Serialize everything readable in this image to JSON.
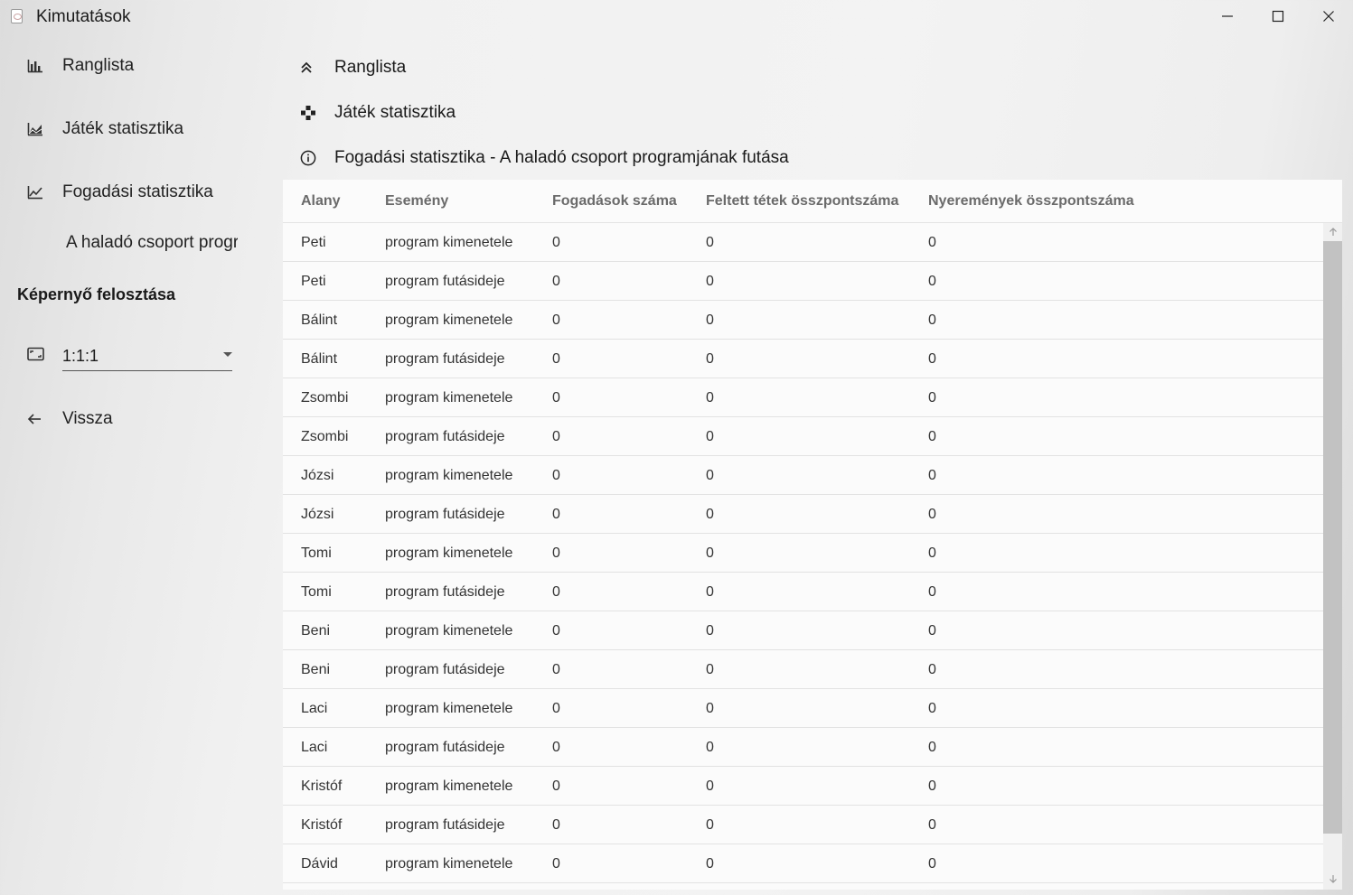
{
  "window": {
    "title": "Kimutatások"
  },
  "sidebar": {
    "nav": [
      {
        "label": "Ranglista",
        "icon": "bar-chart-icon"
      },
      {
        "label": "Játék statisztika",
        "icon": "area-chart-icon"
      },
      {
        "label": "Fogadási statisztika",
        "icon": "line-chart-icon"
      }
    ],
    "sub_item": "A haladó csoport programjának futása",
    "split_section": {
      "heading": "Képernyő felosztása",
      "value": "1:1:1",
      "icon": "aspect-ratio-icon"
    },
    "back": {
      "label": "Vissza",
      "icon": "arrow-left-icon"
    }
  },
  "main": {
    "items": [
      {
        "label": "Ranglista",
        "icon": "double-chevron-up-icon"
      },
      {
        "label": "Játék statisztika",
        "icon": "gamepad-icon"
      },
      {
        "label": "Fogadási statisztika - A haladó csoport programjának futása",
        "icon": "info-icon"
      }
    ]
  },
  "table": {
    "columns": [
      "Alany",
      "Esemény",
      "Fogadások száma",
      "Feltett tétek összpontszáma",
      "Nyeremények összpontszáma"
    ],
    "rows": [
      [
        "Peti",
        "program kimenetele",
        "0",
        "0",
        "0"
      ],
      [
        "Peti",
        "program futásideje",
        "0",
        "0",
        "0"
      ],
      [
        "Bálint",
        "program kimenetele",
        "0",
        "0",
        "0"
      ],
      [
        "Bálint",
        "program futásideje",
        "0",
        "0",
        "0"
      ],
      [
        "Zsombi",
        "program kimenetele",
        "0",
        "0",
        "0"
      ],
      [
        "Zsombi",
        "program futásideje",
        "0",
        "0",
        "0"
      ],
      [
        "Józsi",
        "program kimenetele",
        "0",
        "0",
        "0"
      ],
      [
        "Józsi",
        "program futásideje",
        "0",
        "0",
        "0"
      ],
      [
        "Tomi",
        "program kimenetele",
        "0",
        "0",
        "0"
      ],
      [
        "Tomi",
        "program futásideje",
        "0",
        "0",
        "0"
      ],
      [
        "Beni",
        "program kimenetele",
        "0",
        "0",
        "0"
      ],
      [
        "Beni",
        "program futásideje",
        "0",
        "0",
        "0"
      ],
      [
        "Laci",
        "program kimenetele",
        "0",
        "0",
        "0"
      ],
      [
        "Laci",
        "program futásideje",
        "0",
        "0",
        "0"
      ],
      [
        "Kristóf",
        "program kimenetele",
        "0",
        "0",
        "0"
      ],
      [
        "Kristóf",
        "program futásideje",
        "0",
        "0",
        "0"
      ],
      [
        "Dávid",
        "program kimenetele",
        "0",
        "0",
        "0"
      ]
    ]
  },
  "colors": {
    "table_bg": "#fbfbfb",
    "scroll_thumb": "#c2c2c2",
    "text": "#1b1b1b"
  }
}
